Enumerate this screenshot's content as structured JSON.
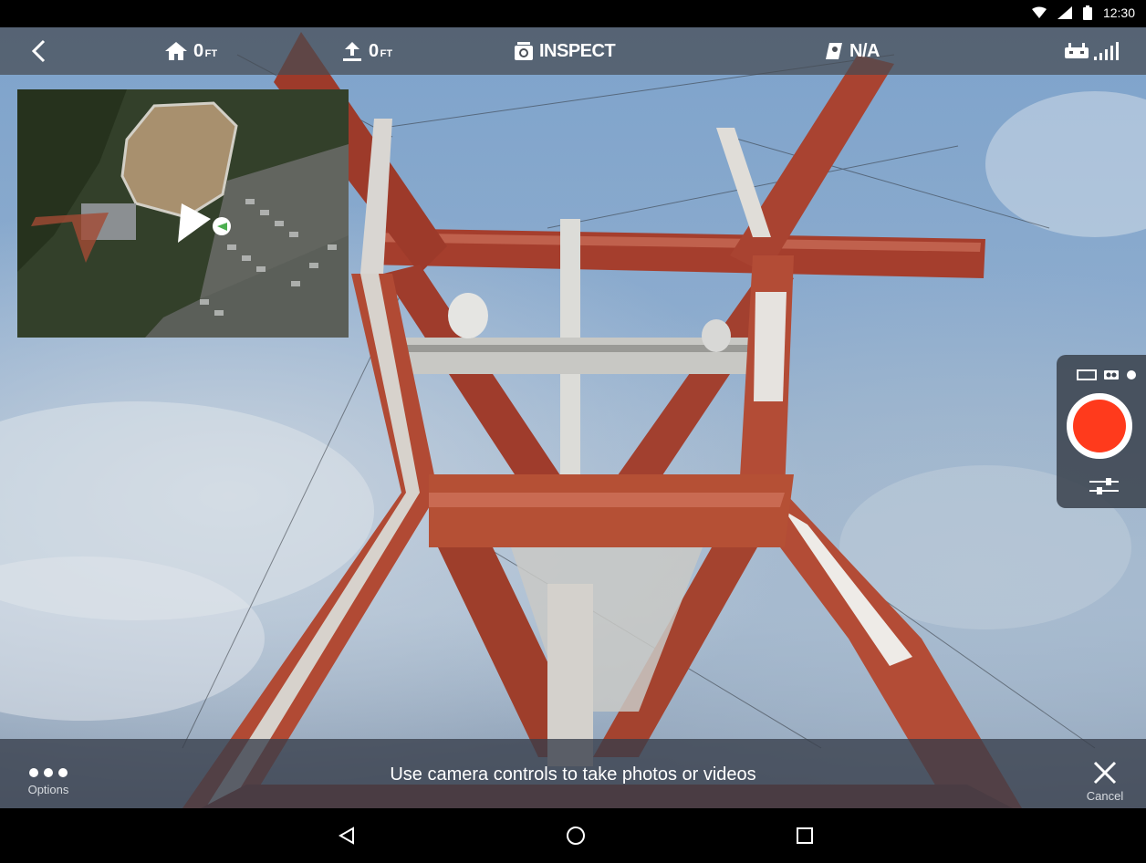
{
  "status_bar": {
    "time": "12:30",
    "icons": [
      "wifi-icon",
      "cell-signal-icon",
      "battery-icon"
    ]
  },
  "top_bar": {
    "back_icon": "chevron-left-icon",
    "home_distance": {
      "icon": "home-icon",
      "value": "0",
      "unit": "FT"
    },
    "altitude": {
      "icon": "upload-arrow-icon",
      "value": "0",
      "unit": "FT"
    },
    "mode": {
      "icon": "camera-icon",
      "label": "INSPECT"
    },
    "gps": {
      "icon": "map-marker-icon",
      "label": "N/A"
    },
    "signal": {
      "icon": "remote-controller-icon",
      "bars": 5
    }
  },
  "camera_panel": {
    "mode_icons": [
      "video-mode-icon",
      "photo-mode-icon",
      "dot-indicator-icon"
    ],
    "record_icon": "record-icon",
    "settings_icon": "sliders-icon"
  },
  "bottom_bar": {
    "options_label": "Options",
    "hint": "Use camera controls to take photos or videos",
    "cancel_label": "Cancel"
  },
  "nav_bar": {
    "back": "nav-back-icon",
    "home": "nav-home-icon",
    "recents": "nav-recents-icon"
  },
  "colors": {
    "record": "#ff3a1c",
    "drone_marker": "#4caf50",
    "tower_red": "#b0452f",
    "tower_white": "#e7e4e0"
  }
}
